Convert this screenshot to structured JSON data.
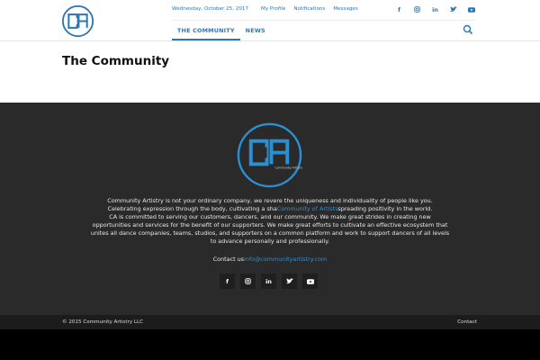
{
  "header": {
    "logo_text": "CA",
    "date": "Wednesday, October 25, 2017",
    "top_links": [
      "My Profile",
      "Notifications",
      "Messages"
    ],
    "social_icons": [
      "facebook-icon",
      "instagram-icon",
      "linkedin-icon",
      "twitter-icon",
      "youtube-icon"
    ],
    "nav": [
      {
        "label": "THE COMMUNITY",
        "active": true
      },
      {
        "label": "NEWS",
        "active": false
      }
    ]
  },
  "page": {
    "title": "The Community"
  },
  "footer": {
    "logo_text": "CA",
    "logo_subtitle": "Community Artistry",
    "about_line1": "Community Artistry is not your ordinary company, we revere the uniqueness and individuality of people like you.",
    "about_line2_pre": "Celebrating expression through the body, cultivating a sha",
    "about_line2_hl": "Community of Artists",
    "about_line2_post": "spreading positivity in the world.",
    "about_line3": "CA is committed to serving our customers, dancers, and our community. We make great strides in creating new opportunities and services for the benefit of our supporters. We make great efforts to cultivate an effective ecosystem that unites all dance companies, teams, studios, and supporters on a common platform and work to support dancers of all levels to advance personally and professionally.",
    "contact_label": "Contact us",
    "contact_email": "info@communityartistry.com",
    "social_icons": [
      "facebook-icon",
      "instagram-icon",
      "linkedin-icon",
      "twitter-icon",
      "youtube-icon"
    ]
  },
  "bottom": {
    "copyright": "© 2015 Community Artistry LLC",
    "contact": "Contact"
  },
  "colors": {
    "accent": "#2a78b6",
    "footer_bg": "#2a2a2a",
    "bottom_bg": "#1c1c1c"
  }
}
